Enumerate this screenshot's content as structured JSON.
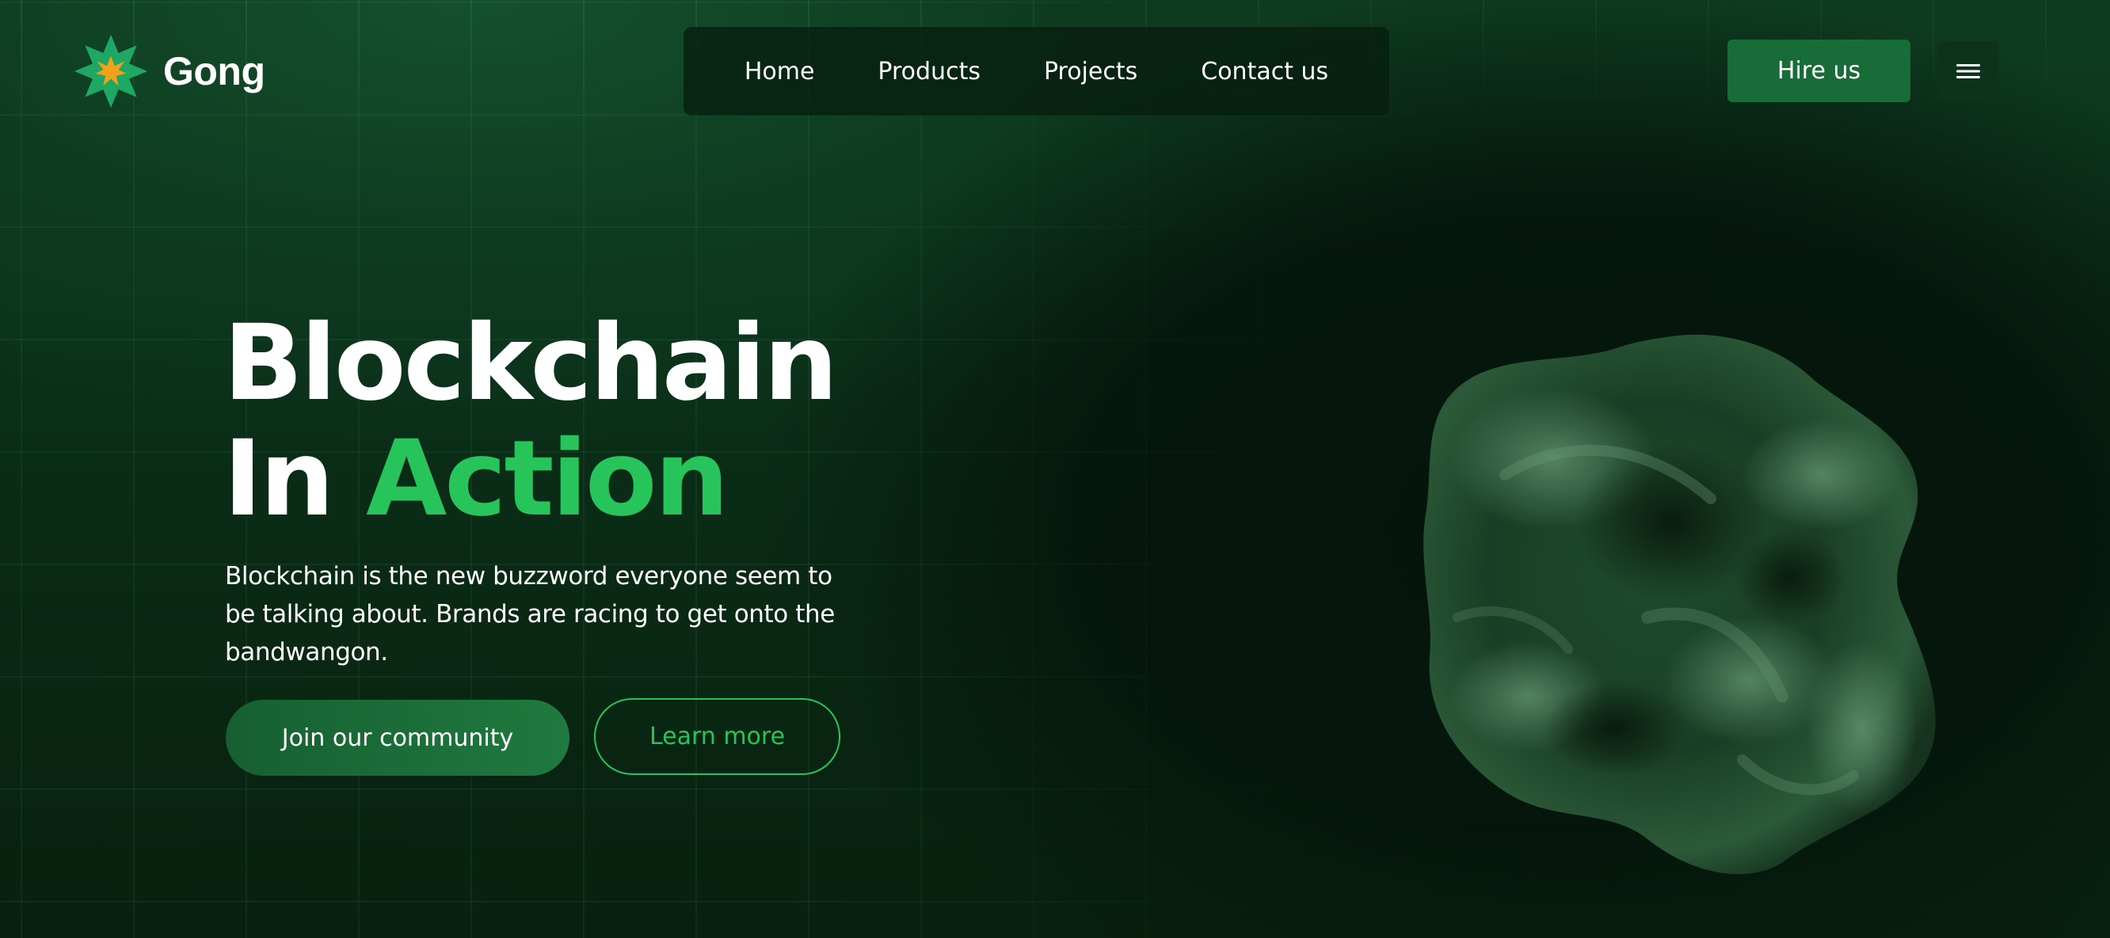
{
  "brand": {
    "name": "Gong",
    "logo_icon": "star-burst-icon",
    "colors": {
      "primary": "#27c45c",
      "button": "#186c38",
      "star_outer": "#1fa864",
      "star_inner": "#f2a21a"
    }
  },
  "nav": {
    "items": [
      {
        "label": "Home"
      },
      {
        "label": "Products"
      },
      {
        "label": "Projects"
      },
      {
        "label": "Contact us"
      }
    ]
  },
  "header": {
    "hire_label": "Hire us",
    "menu_icon": "hamburger-menu-icon"
  },
  "hero": {
    "title_line1": "Blockchain",
    "title_line2_prefix": "In",
    "title_line2_accent": "Action",
    "description": "Blockchain is the new buzzword everyone seem to be talking about. Brands are racing to get onto the bandwangon.",
    "primary_cta": "Join our community",
    "secondary_cta": "Learn more"
  },
  "artwork": {
    "icon": "abstract-3d-blob-illustration"
  }
}
